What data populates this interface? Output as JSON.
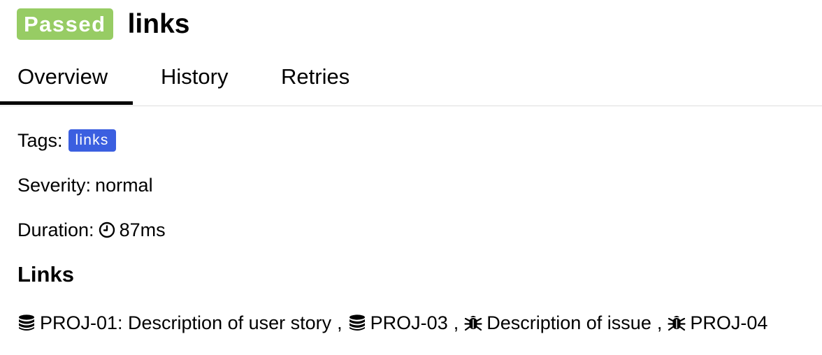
{
  "header": {
    "status": "Passed",
    "title": "links"
  },
  "tabs": [
    {
      "label": "Overview",
      "active": true
    },
    {
      "label": "History",
      "active": false
    },
    {
      "label": "Retries",
      "active": false
    }
  ],
  "tags": {
    "label": "Tags:",
    "items": [
      "links"
    ]
  },
  "severity": {
    "label": "Severity:",
    "value": "normal"
  },
  "duration": {
    "label": "Duration:",
    "icon": "clock-icon",
    "value": "87ms"
  },
  "links_section": {
    "heading": "Links",
    "separator": ",",
    "items": [
      {
        "icon": "database-icon",
        "text": "PROJ-01: Description of user story"
      },
      {
        "icon": "database-icon",
        "text": "PROJ-03"
      },
      {
        "icon": "bug-icon",
        "text": "Description of issue"
      },
      {
        "icon": "bug-icon",
        "text": "PROJ-04"
      }
    ]
  },
  "colors": {
    "passed": "#97cc64",
    "tag": "#3b5fe0",
    "tab_active": "#000000",
    "divider": "#dddddd"
  }
}
